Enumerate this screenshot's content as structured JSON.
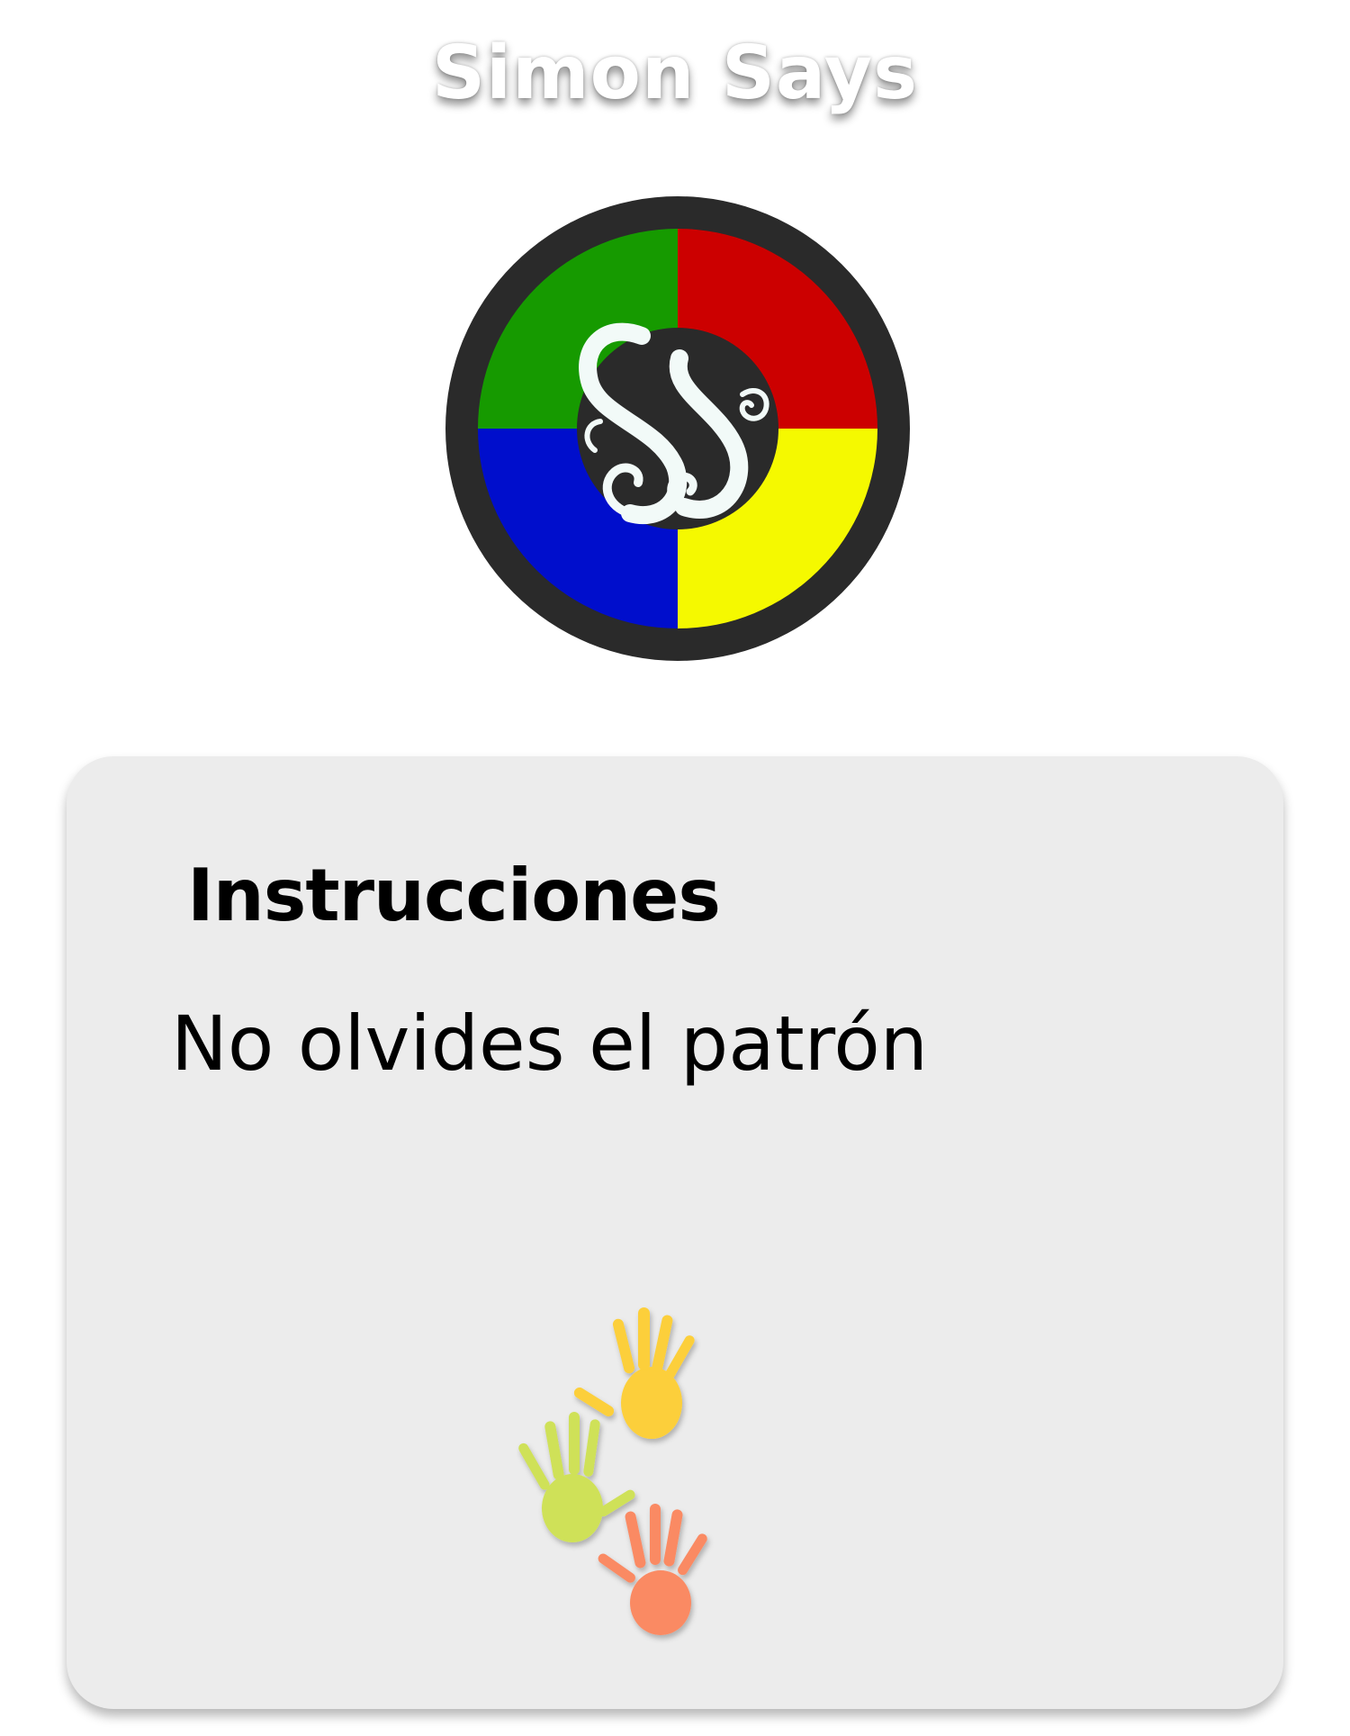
{
  "app": {
    "title": "Simon Says"
  },
  "logo": {
    "icon": "simon-says-logo-icon",
    "monogram": "SS",
    "colors": {
      "ring": "#2a2a2a",
      "green": "#169a00",
      "red": "#cc0000",
      "blue": "#000ecc",
      "yellow": "#f5f900",
      "monogram": "#f2faf8"
    }
  },
  "instructions": {
    "heading": "Instrucciones",
    "text": "No olvides el patrón"
  },
  "decoration": {
    "icon": "handprints-icon",
    "colors": {
      "yellow_hand": "#fccf3a",
      "green_hand": "#cfe158",
      "orange_hand": "#fa8a63"
    }
  },
  "theme": {
    "card_background": "#ececec",
    "page_background": "#ffffff"
  }
}
